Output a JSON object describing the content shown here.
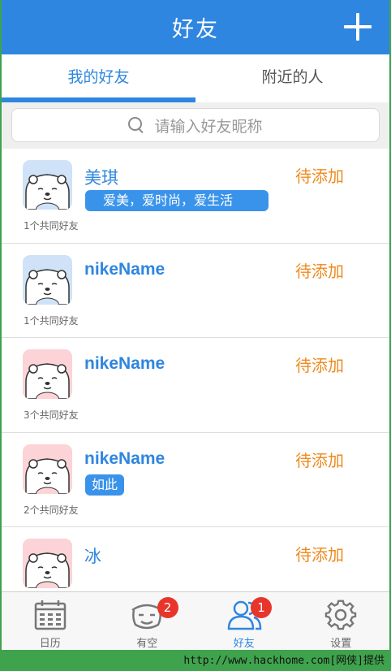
{
  "header": {
    "title": "好友"
  },
  "tabs": [
    {
      "label": "我的好友",
      "active": true
    },
    {
      "label": "附近的人",
      "active": false
    }
  ],
  "search": {
    "placeholder": "请输入好友昵称"
  },
  "friends": [
    {
      "name": "美琪",
      "status": "待添加",
      "tag": "爱美，爱时尚，爱生活",
      "mutual": "1个共同好友",
      "avatar_bg": "#cfe2f7"
    },
    {
      "name": "nikeName",
      "status": "待添加",
      "tag": "",
      "mutual": "1个共同好友",
      "avatar_bg": "#cfe2f7"
    },
    {
      "name": "nikeName",
      "status": "待添加",
      "tag": "",
      "mutual": "3个共同好友",
      "avatar_bg": "#fcd3d6"
    },
    {
      "name": "nikeName",
      "status": "待添加",
      "tag": "如此",
      "mutual": "2个共同好友",
      "avatar_bg": "#fcd3d6"
    },
    {
      "name": "冰",
      "status": "待添加",
      "tag": "",
      "mutual": "",
      "avatar_bg": "#fcd3d6"
    }
  ],
  "tabbar": [
    {
      "label": "日历",
      "icon": "calendar-icon",
      "badge": "",
      "active": false
    },
    {
      "label": "有空",
      "icon": "smiley-icon",
      "badge": "2",
      "active": false
    },
    {
      "label": "好友",
      "icon": "friends-icon",
      "badge": "1",
      "active": true
    },
    {
      "label": "设置",
      "icon": "gear-icon",
      "badge": "",
      "active": false
    }
  ],
  "watermark": "http://www.hackhome.com[网侠]提供",
  "colors": {
    "primary": "#2f86e0",
    "pending": "#ee8a1e",
    "badge": "#e8352c"
  }
}
